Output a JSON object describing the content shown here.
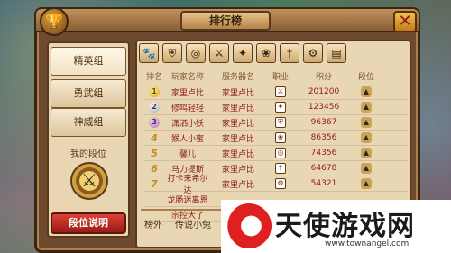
{
  "header": {
    "title": "排行榜",
    "close_icon": "close-x-icon"
  },
  "groups": [
    "精英组",
    "勇武组",
    "神威组"
  ],
  "my_rank": {
    "label": "我的段位",
    "button_label": "段位说明"
  },
  "class_tabs": [
    "paw-icon",
    "shield-icon",
    "ring-icon",
    "crossed-swords-icon",
    "magic-icon",
    "fairy-icon",
    "sword-icon",
    "gear-icon",
    "book-icon"
  ],
  "table": {
    "columns": [
      "排名",
      "玩家名称",
      "服务器名",
      "职业",
      "积分",
      "段位"
    ],
    "rows": [
      {
        "rank": "1",
        "name": "家里卢比",
        "server": "家里卢比",
        "score": "201200"
      },
      {
        "rank": "2",
        "name": "修鸣轻轻",
        "server": "家里卢比",
        "score": "123456"
      },
      {
        "rank": "3",
        "name": "潇洒小妖",
        "server": "家里卢比",
        "score": "96367"
      },
      {
        "rank": "4",
        "name": "猴人小蜜",
        "server": "家里卢比",
        "score": "86356"
      },
      {
        "rank": "5",
        "name": "馨儿",
        "server": "家里卢比",
        "score": "74356"
      },
      {
        "rank": "6",
        "name": "马力提斯",
        "server": "家里卢比",
        "score": "64678"
      },
      {
        "rank": "7",
        "name": "打卡来希尔达",
        "server": "家里卢比",
        "score": "54321"
      },
      {
        "rank": "",
        "name": "龙肠迷离恩",
        "server": "",
        "score": ""
      },
      {
        "rank": "",
        "name": "宗控大了",
        "server": "",
        "score": ""
      }
    ]
  },
  "footer": {
    "outside": "榜外",
    "player": "传说小兔"
  },
  "watermark": {
    "brand": "天使游戏网",
    "url": "www.townangel.com"
  }
}
